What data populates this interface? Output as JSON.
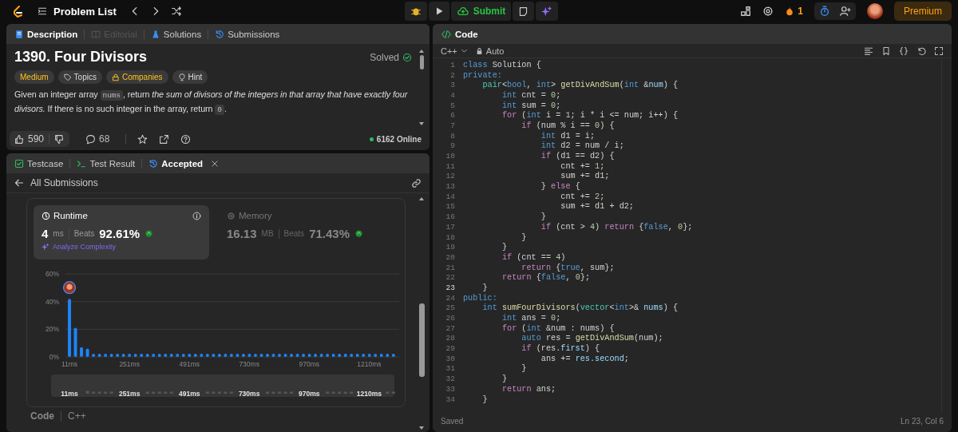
{
  "topbar": {
    "problem_list": "Problem List",
    "submit": "Submit",
    "streak": "1",
    "premium": "Premium"
  },
  "description": {
    "tabs": [
      {
        "label": "Description",
        "selected": true,
        "disabled": false
      },
      {
        "label": "Editorial",
        "selected": false,
        "disabled": true
      },
      {
        "label": "Solutions",
        "selected": false,
        "disabled": false
      },
      {
        "label": "Submissions",
        "selected": false,
        "disabled": false
      }
    ],
    "title": "1390. Four Divisors",
    "status": "Solved",
    "tags": [
      {
        "kind": "difficulty",
        "label": "Medium"
      },
      {
        "kind": "topics",
        "label": "Topics"
      },
      {
        "kind": "companies",
        "label": "Companies"
      },
      {
        "kind": "hint",
        "label": "Hint"
      }
    ],
    "paragraph": [
      {
        "kind": "text",
        "text": "Given an integer array "
      },
      {
        "kind": "code",
        "text": "nums"
      },
      {
        "kind": "text",
        "text": ", return *the sum of divisors of the integers in that array that have exactly four divisors.* If there is no such integer in the array, return "
      },
      {
        "kind": "code",
        "text": "0"
      },
      {
        "kind": "text",
        "text": "."
      }
    ],
    "likes": "590",
    "comments": "68",
    "online": "6162 Online"
  },
  "result": {
    "tabs": [
      {
        "label": "Testcase",
        "selected": false,
        "closable": false
      },
      {
        "label": "Test Result",
        "selected": false,
        "closable": false
      },
      {
        "label": "Accepted",
        "selected": true,
        "closable": true
      }
    ],
    "back": "All Submissions",
    "stats": [
      {
        "kind": "runtime",
        "label": "Runtime",
        "selected": true,
        "value": "4",
        "unit": "ms",
        "beats_label": "Beats",
        "beats": "92.61%",
        "action": "Analyze Complexity"
      },
      {
        "kind": "memory",
        "label": "Memory",
        "selected": false,
        "value": "16.13",
        "unit": "MB",
        "beats_label": "Beats",
        "beats": "71.43%"
      }
    ],
    "chart_data": {
      "type": "bar",
      "x": [
        11,
        35,
        59,
        83,
        107,
        131,
        155,
        179,
        203,
        227,
        251,
        275,
        299,
        323,
        347,
        371,
        395,
        419,
        443,
        467,
        491,
        515,
        539,
        563,
        587,
        611,
        635,
        659,
        683,
        707,
        731,
        755,
        779,
        803,
        827,
        851,
        875,
        899,
        923,
        947,
        971,
        995,
        1019,
        1043,
        1067,
        1091,
        1115,
        1139,
        1163,
        1187,
        1211,
        1235,
        1259,
        1283,
        1307
      ],
      "values": [
        42,
        21,
        7,
        6,
        1.5,
        1.5,
        1.5,
        1.5,
        1.5,
        1.5,
        1.5,
        1.5,
        1.5,
        1.5,
        1.5,
        1.5,
        1.5,
        1.5,
        1.5,
        1.5,
        1.5,
        1.5,
        1.5,
        1.5,
        1.5,
        1.5,
        1.5,
        1.5,
        1.5,
        1.5,
        1.5,
        1.5,
        1.5,
        1.5,
        1.5,
        1.5,
        1.5,
        1.5,
        1.5,
        1.5,
        1.5,
        1.5,
        1.5,
        1.5,
        1.5,
        1.5,
        1.5,
        1.5,
        1.5,
        1.5,
        1.5,
        1.5,
        1.5,
        1.5,
        1.5
      ],
      "xlim": [
        -5,
        1330
      ],
      "ylim": [
        0,
        60
      ],
      "yticks": [
        {
          "value": 0,
          "label": "0%"
        },
        {
          "value": 20,
          "label": "20%"
        },
        {
          "value": 40,
          "label": "40%"
        },
        {
          "value": 60,
          "label": "60%"
        }
      ],
      "xticks": [
        {
          "value": 11,
          "label": "11ms"
        },
        {
          "value": 251,
          "label": "251ms"
        },
        {
          "value": 491,
          "label": "491ms"
        },
        {
          "value": 730,
          "label": "730ms"
        },
        {
          "value": 970,
          "label": "970ms"
        },
        {
          "value": 1210,
          "label": "1210ms"
        }
      ]
    },
    "brush_labels": [
      "11ms",
      "251ms",
      "491ms",
      "730ms",
      "970ms",
      "1210ms"
    ],
    "footer": {
      "label": "Code",
      "language": "C++"
    }
  },
  "editor": {
    "title": "Code",
    "language": "C++",
    "mode": "Auto",
    "status": "Saved",
    "cursor": "Ln 23, Col 6",
    "lines": [
      {
        "n": "1",
        "current": false,
        "tokens": [
          {
            "kind": "kw",
            "text": "class"
          },
          {
            "kind": "p",
            "text": " Solution {"
          }
        ]
      },
      {
        "n": "2",
        "current": false,
        "tokens": [
          {
            "kind": "kw",
            "text": "private:"
          }
        ]
      },
      {
        "n": "3",
        "current": false,
        "tokens": [
          {
            "kind": "ty",
            "text": "    pair"
          },
          {
            "kind": "p",
            "text": "<"
          },
          {
            "kind": "kw",
            "text": "bool"
          },
          {
            "kind": "p",
            "text": ", "
          },
          {
            "kind": "kw",
            "text": "int"
          },
          {
            "kind": "p",
            "text": "> "
          },
          {
            "kind": "fn",
            "text": "getDivAndSum"
          },
          {
            "kind": "p",
            "text": "("
          },
          {
            "kind": "kw",
            "text": "int"
          },
          {
            "kind": "p",
            "text": " &"
          },
          {
            "kind": "v",
            "text": "num"
          },
          {
            "kind": "p",
            "text": ") {"
          }
        ]
      },
      {
        "n": "4",
        "current": false,
        "tokens": [
          {
            "kind": "kw",
            "text": "        int"
          },
          {
            "kind": "p",
            "text": " cnt = "
          },
          {
            "kind": "nm",
            "text": "0"
          },
          {
            "kind": "p",
            "text": ";"
          }
        ]
      },
      {
        "n": "5",
        "current": false,
        "tokens": [
          {
            "kind": "kw",
            "text": "        int"
          },
          {
            "kind": "p",
            "text": " sum = "
          },
          {
            "kind": "nm",
            "text": "0"
          },
          {
            "kind": "p",
            "text": ";"
          }
        ]
      },
      {
        "n": "6",
        "current": false,
        "tokens": [
          {
            "kind": "c",
            "text": "        for"
          },
          {
            "kind": "p",
            "text": " ("
          },
          {
            "kind": "kw",
            "text": "int"
          },
          {
            "kind": "p",
            "text": " i = "
          },
          {
            "kind": "nm",
            "text": "1"
          },
          {
            "kind": "p",
            "text": "; i * i <= num; i++) {"
          }
        ]
      },
      {
        "n": "7",
        "current": false,
        "tokens": [
          {
            "kind": "c",
            "text": "            if"
          },
          {
            "kind": "p",
            "text": " (num % i == "
          },
          {
            "kind": "nm",
            "text": "0"
          },
          {
            "kind": "p",
            "text": ") {"
          }
        ]
      },
      {
        "n": "8",
        "current": false,
        "tokens": [
          {
            "kind": "kw",
            "text": "                int"
          },
          {
            "kind": "p",
            "text": " d1 = i;"
          }
        ]
      },
      {
        "n": "9",
        "current": false,
        "tokens": [
          {
            "kind": "kw",
            "text": "                int"
          },
          {
            "kind": "p",
            "text": " d2 = num / i;"
          }
        ]
      },
      {
        "n": "10",
        "current": false,
        "tokens": [
          {
            "kind": "c",
            "text": "                if"
          },
          {
            "kind": "p",
            "text": " (d1 == d2) {"
          }
        ]
      },
      {
        "n": "11",
        "current": false,
        "tokens": [
          {
            "kind": "p",
            "text": "                    cnt += "
          },
          {
            "kind": "nm",
            "text": "1"
          },
          {
            "kind": "p",
            "text": ";"
          }
        ]
      },
      {
        "n": "12",
        "current": false,
        "tokens": [
          {
            "kind": "p",
            "text": "                    sum += d1;"
          }
        ]
      },
      {
        "n": "13",
        "current": false,
        "tokens": [
          {
            "kind": "p",
            "text": "                } "
          },
          {
            "kind": "c",
            "text": "else"
          },
          {
            "kind": "p",
            "text": " {"
          }
        ]
      },
      {
        "n": "14",
        "current": false,
        "tokens": [
          {
            "kind": "p",
            "text": "                    cnt += "
          },
          {
            "kind": "nm",
            "text": "2"
          },
          {
            "kind": "p",
            "text": ";"
          }
        ]
      },
      {
        "n": "15",
        "current": false,
        "tokens": [
          {
            "kind": "p",
            "text": "                    sum += d1 + d2;"
          }
        ]
      },
      {
        "n": "16",
        "current": false,
        "tokens": [
          {
            "kind": "p",
            "text": "                }"
          }
        ]
      },
      {
        "n": "17",
        "current": false,
        "tokens": [
          {
            "kind": "c",
            "text": "                if"
          },
          {
            "kind": "p",
            "text": " (cnt > "
          },
          {
            "kind": "nm",
            "text": "4"
          },
          {
            "kind": "p",
            "text": ") "
          },
          {
            "kind": "c",
            "text": "return"
          },
          {
            "kind": "p",
            "text": " {"
          },
          {
            "kind": "kw",
            "text": "false"
          },
          {
            "kind": "p",
            "text": ", "
          },
          {
            "kind": "nm",
            "text": "0"
          },
          {
            "kind": "p",
            "text": "};"
          }
        ]
      },
      {
        "n": "18",
        "current": false,
        "tokens": [
          {
            "kind": "p",
            "text": "            }"
          }
        ]
      },
      {
        "n": "19",
        "current": false,
        "tokens": [
          {
            "kind": "p",
            "text": "        }"
          }
        ]
      },
      {
        "n": "20",
        "current": false,
        "tokens": [
          {
            "kind": "c",
            "text": "        if"
          },
          {
            "kind": "p",
            "text": " (cnt == "
          },
          {
            "kind": "nm",
            "text": "4"
          },
          {
            "kind": "p",
            "text": ")"
          }
        ]
      },
      {
        "n": "21",
        "current": false,
        "tokens": [
          {
            "kind": "c",
            "text": "            return"
          },
          {
            "kind": "p",
            "text": " {"
          },
          {
            "kind": "kw",
            "text": "true"
          },
          {
            "kind": "p",
            "text": ", sum};"
          }
        ]
      },
      {
        "n": "22",
        "current": false,
        "tokens": [
          {
            "kind": "c",
            "text": "        return"
          },
          {
            "kind": "p",
            "text": " {"
          },
          {
            "kind": "kw",
            "text": "false"
          },
          {
            "kind": "p",
            "text": ", "
          },
          {
            "kind": "nm",
            "text": "0"
          },
          {
            "kind": "p",
            "text": "};"
          }
        ]
      },
      {
        "n": "23",
        "current": true,
        "tokens": [
          {
            "kind": "p",
            "text": "    }"
          }
        ]
      },
      {
        "n": "24",
        "current": false,
        "tokens": [
          {
            "kind": "kw",
            "text": "public:"
          }
        ]
      },
      {
        "n": "25",
        "current": false,
        "tokens": [
          {
            "kind": "kw",
            "text": "    int"
          },
          {
            "kind": "fn",
            "text": " sumFourDivisors"
          },
          {
            "kind": "p",
            "text": "("
          },
          {
            "kind": "ty",
            "text": "vector"
          },
          {
            "kind": "p",
            "text": "<"
          },
          {
            "kind": "kw",
            "text": "int"
          },
          {
            "kind": "p",
            "text": ">& "
          },
          {
            "kind": "v",
            "text": "nums"
          },
          {
            "kind": "p",
            "text": ") {"
          }
        ]
      },
      {
        "n": "26",
        "current": false,
        "tokens": [
          {
            "kind": "kw",
            "text": "        int"
          },
          {
            "kind": "p",
            "text": " ans = "
          },
          {
            "kind": "nm",
            "text": "0"
          },
          {
            "kind": "p",
            "text": ";"
          }
        ]
      },
      {
        "n": "27",
        "current": false,
        "tokens": [
          {
            "kind": "c",
            "text": "        for"
          },
          {
            "kind": "p",
            "text": " ("
          },
          {
            "kind": "kw",
            "text": "int"
          },
          {
            "kind": "p",
            "text": " &num : nums) {"
          }
        ]
      },
      {
        "n": "28",
        "current": false,
        "tokens": [
          {
            "kind": "kw",
            "text": "            auto"
          },
          {
            "kind": "p",
            "text": " res = "
          },
          {
            "kind": "fn",
            "text": "getDivAndSum"
          },
          {
            "kind": "p",
            "text": "(num);"
          }
        ]
      },
      {
        "n": "29",
        "current": false,
        "tokens": [
          {
            "kind": "c",
            "text": "            if"
          },
          {
            "kind": "p",
            "text": " (res."
          },
          {
            "kind": "v",
            "text": "first"
          },
          {
            "kind": "p",
            "text": ") {"
          }
        ]
      },
      {
        "n": "30",
        "current": false,
        "tokens": [
          {
            "kind": "p",
            "text": "                ans += "
          },
          {
            "kind": "v",
            "text": "res.second"
          },
          {
            "kind": "p",
            "text": ";"
          }
        ]
      },
      {
        "n": "31",
        "current": false,
        "tokens": [
          {
            "kind": "p",
            "text": "            }"
          }
        ]
      },
      {
        "n": "32",
        "current": false,
        "tokens": [
          {
            "kind": "p",
            "text": "        }"
          }
        ]
      },
      {
        "n": "33",
        "current": false,
        "tokens": [
          {
            "kind": "c",
            "text": "        return"
          },
          {
            "kind": "p",
            "text": " ans;"
          }
        ]
      },
      {
        "n": "34",
        "current": false,
        "tokens": [
          {
            "kind": "p",
            "text": "    }"
          }
        ]
      }
    ]
  }
}
